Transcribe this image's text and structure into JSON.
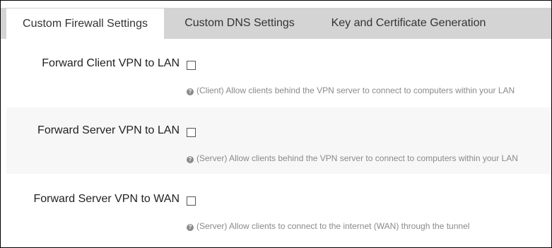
{
  "tabs": [
    {
      "label": "Custom Firewall Settings",
      "active": true
    },
    {
      "label": "Custom DNS Settings",
      "active": false
    },
    {
      "label": "Key and Certificate Generation",
      "active": false
    }
  ],
  "settings": [
    {
      "label": "Forward Client VPN to LAN",
      "checked": false,
      "help_icon": "question-circle-icon",
      "help": "(Client) Allow clients behind the VPN server to connect to computers within your LAN"
    },
    {
      "label": "Forward Server VPN to LAN",
      "checked": false,
      "help_icon": "question-circle-icon",
      "help": "(Server) Allow clients behind the VPN server to connect to computers within your LAN"
    },
    {
      "label": "Forward Server VPN to WAN",
      "checked": false,
      "help_icon": "question-circle-icon",
      "help": "(Server) Allow clients to connect to the internet (WAN) through the tunnel"
    }
  ],
  "colors": {
    "tab_bar": "#d4d4d4",
    "active_tab": "#ffffff",
    "shaded_row": "#f7f7f7",
    "help_text": "#8a8a8a"
  }
}
